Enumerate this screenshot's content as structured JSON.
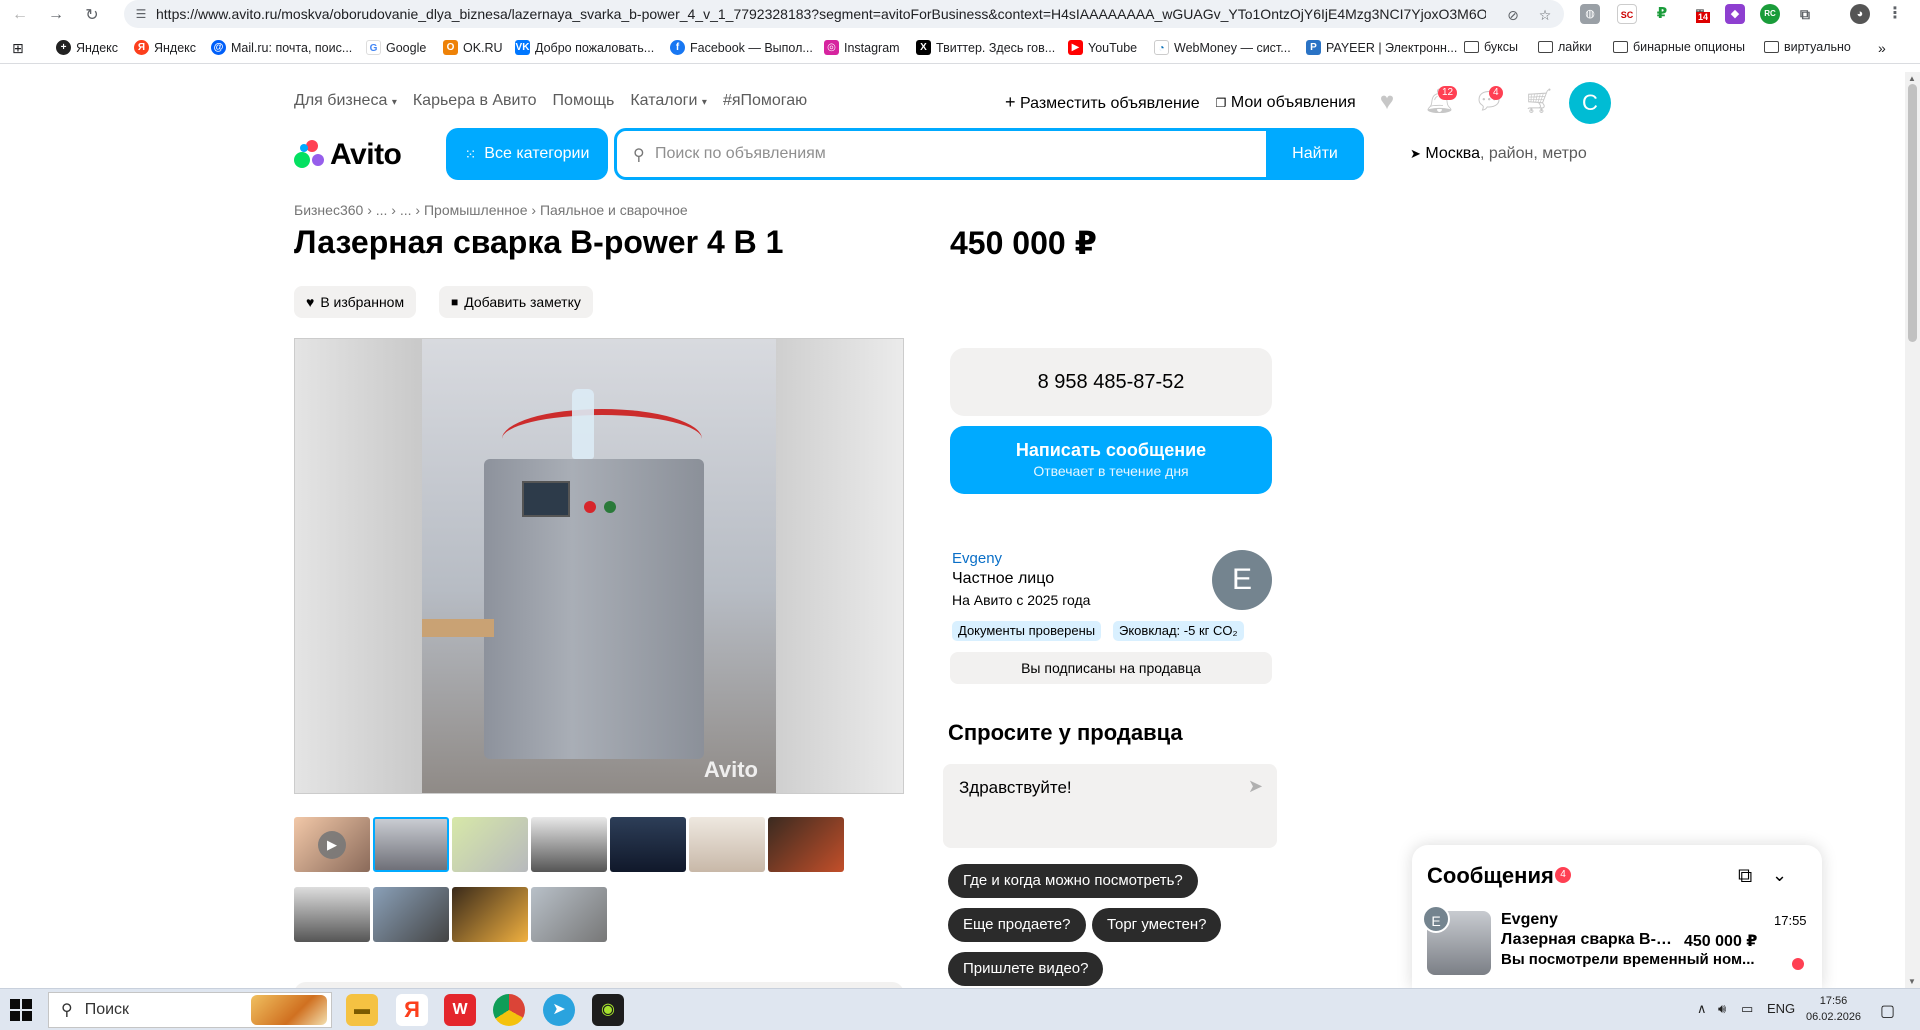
{
  "browser": {
    "url": "https://www.avito.ru/moskva/oborudovanie_dlya_biznesa/lazernaya_svarka_b-power_4_v_1_7792328183?segment=avitoForBusiness&context=H4sIAAAAAAAA_wGUAGv_YTo1OntzOjY6IjE4Mzg3NCI7YjoxO3M6OToiZ...",
    "ext_badge": "14",
    "bookmarks": [
      "Яндекс",
      "Яндекс",
      "Mail.ru: почта, поис...",
      "Google",
      "OK.RU",
      "Добро пожаловать...",
      "Facebook — Выпол...",
      "Instagram",
      "Твиттер. Здесь гов...",
      "YouTube",
      "WebMoney — сист...",
      "PAYEER | Электронн...",
      "буксы",
      "лайки",
      "бинарные опционы",
      "виртуально"
    ]
  },
  "header": {
    "nav": [
      "Для бизнеса",
      "Карьера в Авито",
      "Помощь",
      "Каталоги",
      "#яПомогаю"
    ],
    "post_ad": "Разместить объявление",
    "my_ads": "Мои объявления",
    "notif_count": "12",
    "msg_count": "4",
    "avatar_letter": "C",
    "logo": "Avito",
    "all_categories": "Все категории",
    "search_placeholder": "Поиск по объявлениям",
    "find": "Найти",
    "location_city": "Москва",
    "location_rest": ", район, метро"
  },
  "listing": {
    "breadcrumb": "Бизнес360 › ... › ... › Промышленное › Паяльное и сварочное",
    "title": "Лазерная сварка B-power 4 В 1",
    "price": "450 000 ₽",
    "favorite": "В избранном",
    "add_note": "Добавить заметку",
    "watermark": "Avito"
  },
  "contact": {
    "phone": "8 958 485-87-52",
    "write_message": "Написать сообщение",
    "reply_time": "Отвечает в течение дня"
  },
  "seller": {
    "name": "Evgeny",
    "type": "Частное лицо",
    "since": "На Авито с 2025 года",
    "avatar_letter": "E",
    "tag_docs": "Документы проверены",
    "tag_eco": "Эковклад: -5 кг CO₂",
    "subscribed": "Вы подписаны на продавца"
  },
  "ask": {
    "heading": "Спросите у продавца",
    "text": "Здравствуйте!",
    "chips": [
      "Где и когда можно посмотреть?",
      "Еще продаете?",
      "Торг уместен?",
      "Пришлете видео?"
    ]
  },
  "messages": {
    "heading": "Сообщения",
    "badge": "4",
    "name": "Evgeny",
    "time": "17:55",
    "item": "Лазерная сварка B-ро...",
    "price": "450 000 ₽",
    "last": "Вы посмотрели временный ном...",
    "avatar_letter": "E"
  },
  "taskbar": {
    "search": "Поиск",
    "lang": "ENG",
    "time": "17:56",
    "date": "06.02.2026"
  }
}
